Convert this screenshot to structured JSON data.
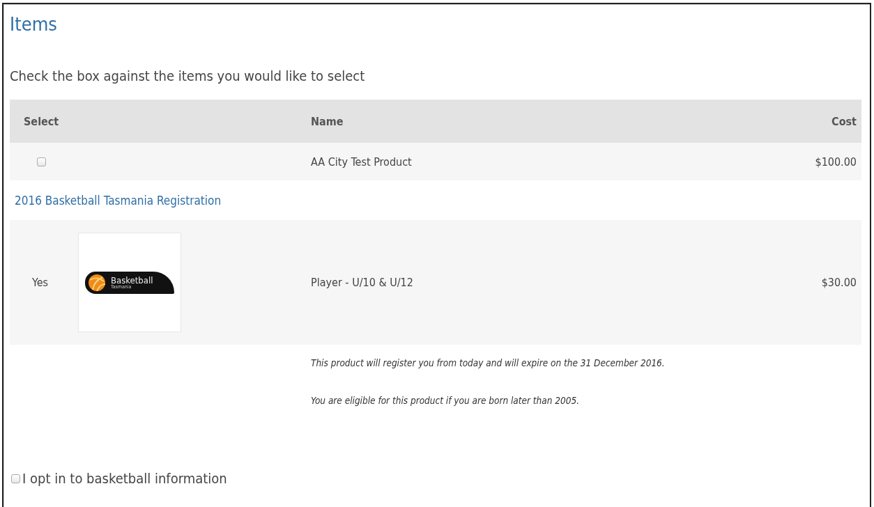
{
  "title": "Items",
  "instruction": "Check the box against the items you would like to select",
  "table": {
    "columns": [
      "Select",
      "Name",
      "Cost"
    ],
    "rows": [
      {
        "kind": "item",
        "checked": false,
        "name": "AA City Test Product",
        "cost": "$100.00"
      },
      {
        "kind": "group",
        "label": "2016 Basketball Tasmania Registration"
      },
      {
        "kind": "product",
        "select_text": "Yes",
        "logo": {
          "title": "Basketball",
          "subtitle": "Tasmania"
        },
        "name": "Player - U/10 & U/12",
        "cost": "$30.00",
        "notes": [
          "This product will register you from today and will expire on the 31 December 2016.",
          "You are eligible for this product if you are born later than 2005."
        ]
      }
    ]
  },
  "opt_in": {
    "label": "I opt in to basketball information",
    "checked": false
  }
}
